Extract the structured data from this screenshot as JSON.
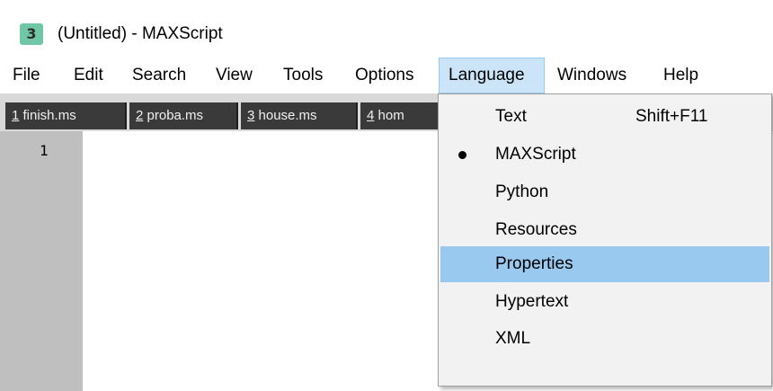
{
  "window": {
    "app_icon_glyph": "3",
    "title": "(Untitled) - MAXScript"
  },
  "menubar": {
    "items": [
      {
        "label": "File"
      },
      {
        "label": "Edit"
      },
      {
        "label": "Search"
      },
      {
        "label": "View"
      },
      {
        "label": "Tools"
      },
      {
        "label": "Options"
      },
      {
        "label": "Language"
      },
      {
        "label": "Windows"
      },
      {
        "label": "Help"
      }
    ],
    "active": "Language"
  },
  "tabs": [
    {
      "num": "1",
      "label": " finish.ms"
    },
    {
      "num": "2",
      "label": " proba.ms"
    },
    {
      "num": "3",
      "label": " house.ms"
    },
    {
      "num": "4",
      "label": " hom"
    }
  ],
  "editor": {
    "line_numbers": [
      "1"
    ]
  },
  "language_menu": {
    "items": [
      {
        "label": "Text",
        "shortcut": "Shift+F11",
        "checked": false,
        "highlighted": false
      },
      {
        "label": "MAXScript",
        "shortcut": "",
        "checked": true,
        "highlighted": false
      },
      {
        "label": "Python",
        "shortcut": "",
        "checked": false,
        "highlighted": false
      },
      {
        "label": "Resources",
        "shortcut": "",
        "checked": false,
        "highlighted": false
      },
      {
        "label": "Properties",
        "shortcut": "",
        "checked": false,
        "highlighted": true
      },
      {
        "label": "Hypertext",
        "shortcut": "",
        "checked": false,
        "highlighted": false
      },
      {
        "label": "XML",
        "shortcut": "",
        "checked": false,
        "highlighted": false
      }
    ]
  },
  "colors": {
    "menu_highlight": "#99c9ef",
    "active_menu_bg": "#cce4f7",
    "tab_bg": "#3a3a3a",
    "gutter_bg": "#bfbfbf",
    "app_icon_bg": "#6fc7a8"
  },
  "icons": {
    "app": "maxscript-app-icon",
    "checked_item": "bullet-icon"
  }
}
